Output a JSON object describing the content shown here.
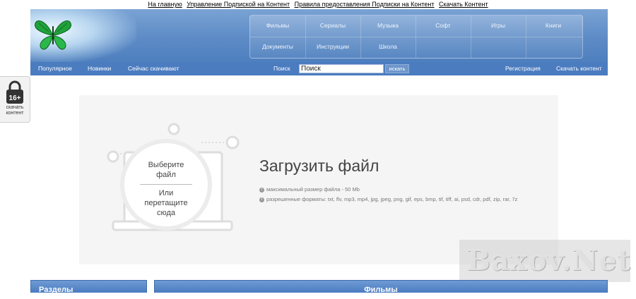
{
  "top_links": [
    "На главную",
    "Управление Подпиской на Контент",
    "Правила предоставления Подписки на Контент",
    "Скачать Контент"
  ],
  "nav": {
    "row1": [
      "Фильмы",
      "Сериалы",
      "Музыка",
      "Софт",
      "Игры",
      "Книги"
    ],
    "row2": [
      "Документы",
      "Инструкции",
      "Школа"
    ]
  },
  "subbar": {
    "left": [
      "Популярное",
      "Новинки",
      "Сейчас скачивают"
    ],
    "search_label": "Поиск",
    "search_value": "Поиск",
    "search_button": "искать",
    "right": [
      "Регистрация",
      "Скачать контент"
    ]
  },
  "age_badge": {
    "age": "16+",
    "label_line1": "скачать",
    "label_line2": "контент"
  },
  "upload": {
    "title": "Загрузить файл",
    "drop_line1": "Выберите",
    "drop_line2": "файл",
    "drop_line3": "Или",
    "drop_line4": "перетащите",
    "drop_line5": "сюда",
    "max_size": "максимальный размер файла - 50 Mb",
    "formats": "разрешенные форматы: txt, flv, mp3, mp4, jpg, jpeg, png, gif, eps, bmp, tif, tiff, ai, psd, cdr, pdf, zip, rar, 7z",
    "info_icon": "i"
  },
  "watermark": "Baxov.Net",
  "bottom_tabs": {
    "sections": "Разделы",
    "films": "Фильмы"
  },
  "colors": {
    "header_blue": "#5d8bc6",
    "subbar_blue": "#4b7cc0",
    "panel_gray": "#f5f5f5"
  }
}
